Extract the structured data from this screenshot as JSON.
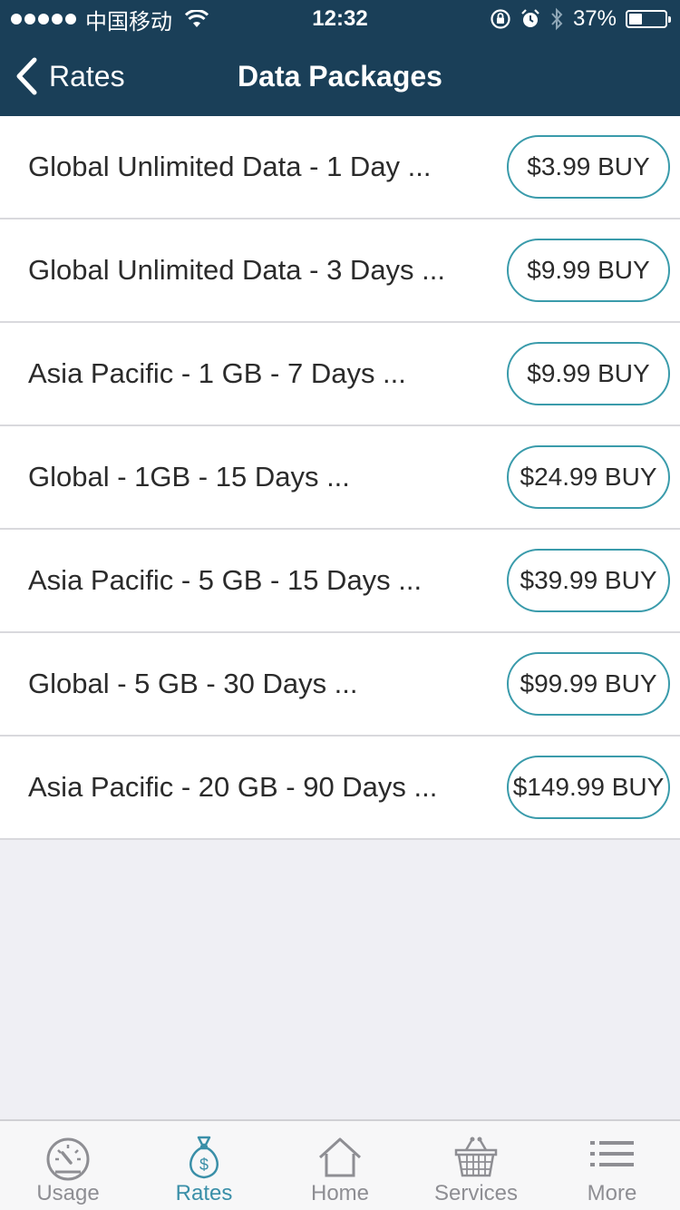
{
  "status_bar": {
    "carrier": "中国移动",
    "time": "12:32",
    "battery_percent": "37%",
    "battery_level": 0.37
  },
  "nav": {
    "back_label": "Rates",
    "title": "Data Packages"
  },
  "packages": [
    {
      "name": "Global Unlimited Data - 1 Day ...",
      "button": "$3.99 BUY"
    },
    {
      "name": "Global Unlimited Data - 3 Days ...",
      "button": "$9.99 BUY"
    },
    {
      "name": "Asia Pacific - 1 GB - 7 Days ...",
      "button": "$9.99 BUY"
    },
    {
      "name": "Global - 1GB - 15 Days ...",
      "button": "$24.99 BUY"
    },
    {
      "name": "Asia Pacific - 5 GB - 15 Days ...",
      "button": "$39.99 BUY"
    },
    {
      "name": "Global - 5 GB - 30 Days ...",
      "button": "$99.99 BUY"
    },
    {
      "name": "Asia Pacific - 20 GB - 90 Days ...",
      "button": "$149.99 BUY"
    }
  ],
  "tabs": [
    {
      "label": "Usage",
      "icon": "speedometer-icon",
      "active": false
    },
    {
      "label": "Rates",
      "icon": "money-bag-icon",
      "active": true
    },
    {
      "label": "Home",
      "icon": "home-icon",
      "active": false
    },
    {
      "label": "Services",
      "icon": "basket-icon",
      "active": false
    },
    {
      "label": "More",
      "icon": "list-icon",
      "active": false
    }
  ],
  "colors": {
    "header_bg": "#1a3f58",
    "accent": "#3a8fa8",
    "button_border": "#3a9bab",
    "tab_inactive": "#8e8e93"
  }
}
